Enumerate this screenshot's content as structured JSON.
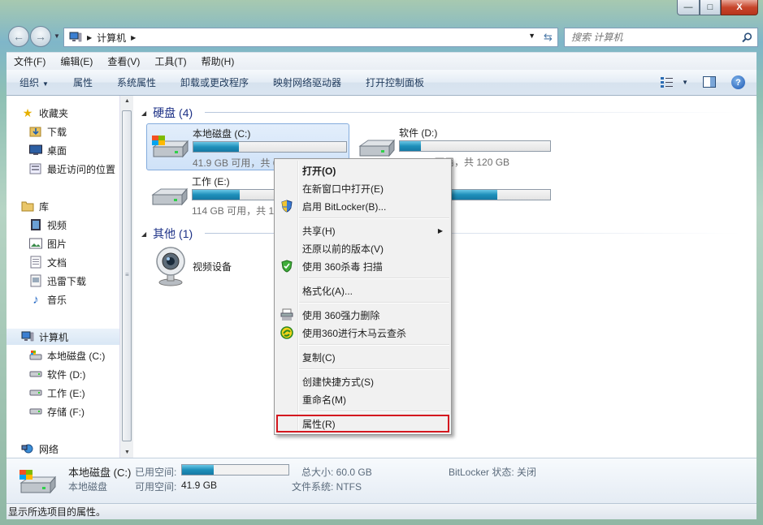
{
  "window": {
    "caption": {
      "minimize": "—",
      "maximize": "□",
      "close": "X"
    }
  },
  "address": {
    "location": "计算机",
    "search_placeholder": "搜索 计算机"
  },
  "menu": [
    "文件(F)",
    "编辑(E)",
    "查看(V)",
    "工具(T)",
    "帮助(H)"
  ],
  "commands": [
    "组织",
    "属性",
    "系统属性",
    "卸载或更改程序",
    "映射网络驱动器",
    "打开控制面板"
  ],
  "nav": {
    "favorites": "收藏夹",
    "downloads": "下载",
    "desktop": "桌面",
    "recent": "最近访问的位置",
    "libraries": "库",
    "videos": "视频",
    "pictures": "图片",
    "documents": "文档",
    "xunlei": "迅雷下载",
    "music": "音乐",
    "computer": "计算机",
    "drive_c": "本地磁盘 (C:)",
    "drive_d": "软件 (D:)",
    "drive_e": "工作 (E:)",
    "drive_f": "存储 (F:)",
    "network": "网络"
  },
  "groups": {
    "hard_disks": "硬盘 (4)",
    "other": "其他 (1)"
  },
  "drives": [
    {
      "name": "本地磁盘 (C:)",
      "info": "41.9 GB 可用，共 60.0 GB",
      "used_fraction": 0.3
    },
    {
      "name": "软件 (D:)",
      "info": "103 GB 可用，共 120 GB",
      "used_fraction": 0.14
    },
    {
      "name": "工作 (E:)",
      "info": "114 GB 可用，共 165 GB",
      "used_fraction": 0.31
    },
    {
      "name": "存储 (F:)",
      "info": "",
      "used_fraction": 0.65
    }
  ],
  "other_devices": [
    {
      "name": "视频设备"
    }
  ],
  "context_menu": {
    "open": "打开(O)",
    "open_new_window": "在新窗口中打开(E)",
    "bitlocker": "启用 BitLocker(B)...",
    "share": "共享(H)",
    "restore": "还原以前的版本(V)",
    "scan_360": "使用 360杀毒 扫描",
    "format": "格式化(A)...",
    "force_delete": "使用 360强力删除",
    "trojan_scan": "使用360进行木马云查杀",
    "copy": "复制(C)",
    "create_shortcut": "创建快捷方式(S)",
    "rename": "重命名(M)",
    "properties": "属性(R)"
  },
  "details": {
    "name": "本地磁盘 (C:)",
    "type": "本地磁盘",
    "used_label": "已用空间:",
    "free_label": "可用空间:",
    "free_value": "41.9 GB",
    "used_fraction": 0.3,
    "total_label": "总大小: 60.0 GB",
    "fs_label": "文件系统: NTFS",
    "bitlocker_label": "BitLocker 状态: 关闭"
  },
  "status": "显示所选项目的属性。",
  "colors": {
    "accent": "#1e3287",
    "drive_fill": "#1e8fba",
    "highlight_border": "#d4181f"
  }
}
